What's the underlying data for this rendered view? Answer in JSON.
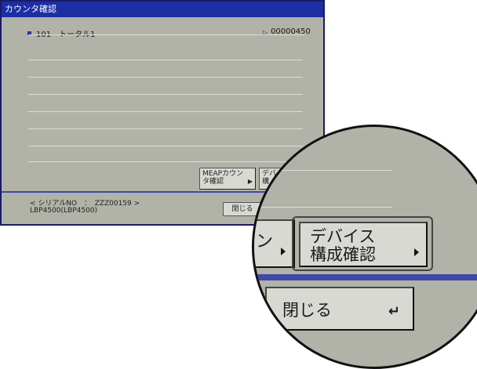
{
  "window": {
    "title": "カウンタ確認"
  },
  "counter": {
    "item": "101　トータル1",
    "value": "00000450"
  },
  "buttons": {
    "meap_counter": "MEAPカウン\nタ確認",
    "device_config_small": "デバ\n構",
    "device_config": "デバイス\n構成確認",
    "close": "閉じる",
    "meap_partial": "ン"
  },
  "footer": {
    "serial": "< シリアルNO　：　ZZZ00159 >",
    "model": "LBP4500(LBP4500)"
  },
  "colors": {
    "title_bg": "#1c2ea3",
    "panel_bg": "#b2b3a8",
    "button_bg": "#d8d9d2"
  }
}
